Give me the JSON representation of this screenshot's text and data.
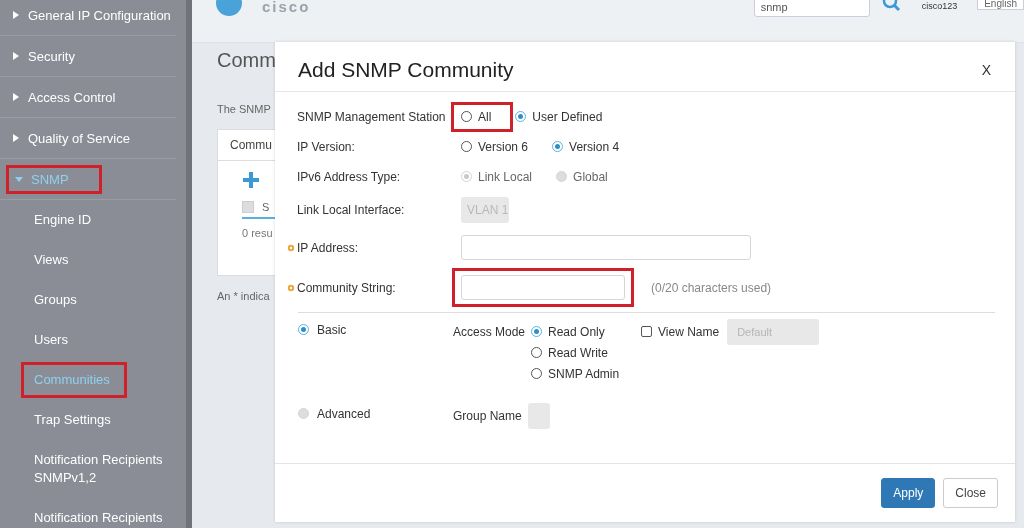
{
  "sidebar": {
    "sections": [
      {
        "label": "General IP Configuration",
        "expanded": false,
        "highlighted": false
      },
      {
        "label": "Security",
        "expanded": false,
        "highlighted": false
      },
      {
        "label": "Access Control",
        "expanded": false,
        "highlighted": false
      },
      {
        "label": "Quality of Service",
        "expanded": false,
        "highlighted": false
      },
      {
        "label": "SNMP",
        "expanded": true,
        "highlighted": true,
        "children": [
          {
            "label": "Engine ID",
            "selected": false,
            "highlighted": false
          },
          {
            "label": "Views",
            "selected": false,
            "highlighted": false
          },
          {
            "label": "Groups",
            "selected": false,
            "highlighted": false
          },
          {
            "label": "Users",
            "selected": false,
            "highlighted": false
          },
          {
            "label": "Communities",
            "selected": true,
            "highlighted": true
          },
          {
            "label": "Trap Settings",
            "selected": false,
            "highlighted": false
          },
          {
            "label": "Notification Recipients SNMPv1,2",
            "selected": false,
            "highlighted": false
          },
          {
            "label": "Notification Recipients",
            "selected": false,
            "highlighted": false
          }
        ]
      }
    ]
  },
  "header": {
    "logo": "cisco",
    "search": {
      "value": "snmp"
    },
    "user": "cisco123",
    "language": "English"
  },
  "page": {
    "title": "Comm",
    "description": "The SNMP",
    "table": {
      "column_1": "Commu",
      "checked": false,
      "column_2": "S",
      "results": "0 resu"
    },
    "footnote": "An * indica"
  },
  "modal": {
    "title": "Add SNMP Community",
    "close": "X",
    "rows": [
      {
        "kind": "radio",
        "label": "SNMP Management Station",
        "required": false,
        "options": [
          {
            "label": "All",
            "selected": false,
            "disabled": false,
            "highlighted": true
          },
          {
            "label": "User Defined",
            "selected": true,
            "disabled": false,
            "highlighted": false
          }
        ]
      },
      {
        "kind": "radio",
        "label": "IP Version:",
        "required": false,
        "options": [
          {
            "label": "Version 6",
            "selected": false,
            "disabled": false,
            "highlighted": false
          },
          {
            "label": "Version 4",
            "selected": true,
            "disabled": false,
            "highlighted": false
          }
        ]
      },
      {
        "kind": "radio",
        "label": "IPv6 Address Type:",
        "required": false,
        "options": [
          {
            "label": "Link Local",
            "selected": true,
            "disabled": true,
            "highlighted": false
          },
          {
            "label": "Global",
            "selected": false,
            "disabled": true,
            "highlighted": false
          }
        ]
      },
      {
        "kind": "select",
        "label": "Link Local Interface:",
        "required": false,
        "value": "VLAN 1",
        "disabled": true
      },
      {
        "kind": "text",
        "label": "IP Address:",
        "required": true,
        "highlighted": false
      },
      {
        "kind": "text",
        "label": "Community String:",
        "required": true,
        "highlighted": true,
        "hint": "(0/20 characters used)"
      }
    ],
    "modes": [
      {
        "label": "Basic",
        "selected": true,
        "disabled": false,
        "field_label": "Access Mode",
        "kind": "access",
        "options": [
          {
            "label": "Read Only",
            "selected": true
          },
          {
            "label": "Read Write",
            "selected": false
          },
          {
            "label": "SNMP Admin",
            "selected": false
          }
        ],
        "view_name": {
          "label": "View Name",
          "checked": false,
          "placeholder": "Default"
        }
      },
      {
        "label": "Advanced",
        "selected": false,
        "disabled": true,
        "field_label": "Group Name",
        "kind": "group"
      }
    ],
    "buttons": [
      {
        "label": "Apply",
        "kind": "primary"
      },
      {
        "label": "Close",
        "kind": "secondary"
      }
    ]
  }
}
